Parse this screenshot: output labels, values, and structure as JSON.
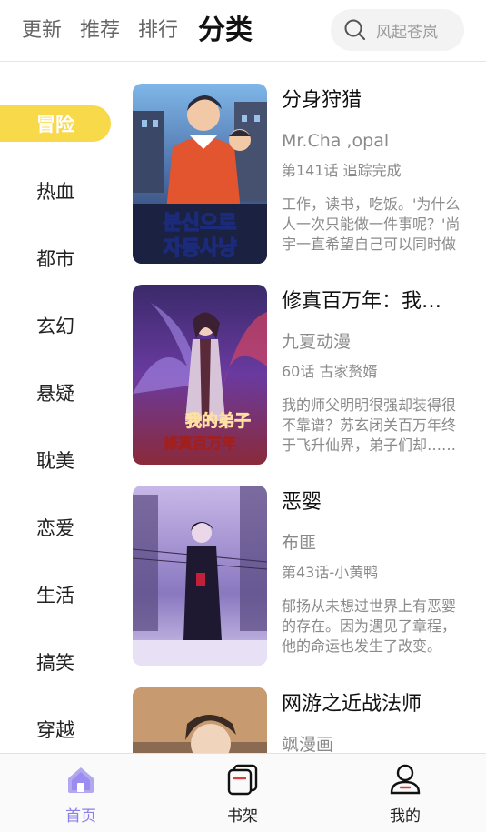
{
  "header": {
    "tabs": [
      {
        "label": "更新"
      },
      {
        "label": "推荐"
      },
      {
        "label": "排行"
      },
      {
        "label": "分类"
      }
    ],
    "search_placeholder": "风起苍岚"
  },
  "categories": [
    "冒险",
    "热血",
    "都市",
    "玄幻",
    "悬疑",
    "耽美",
    "恋爱",
    "生活",
    "搞笑",
    "穿越"
  ],
  "selected_category": "冒险",
  "comics": [
    {
      "title": "分身狩猎",
      "author": "Mr.Cha ,opal",
      "chapter": "第141话 追踪完成",
      "desc": "工作，读书，吃饭。'为什么人一次只能做一件事呢？'尚宇一直希望自己可以同时做很多事情。",
      "cover_text": "분신으로 자동사냥"
    },
    {
      "title": "修真百万年：我…",
      "author": "九夏动漫",
      "chapter": "60话 古家赘婿",
      "desc": "我的师父明明很强却装得很不靠谱？苏玄闭关百万年终于飞升仙界，弟子们却……",
      "cover_text": "我的弟子 修真百万年"
    },
    {
      "title": "恶婴",
      "author": "布匪",
      "chapter": "第43话-小黄鸭",
      "desc": "郁扬从未想过世界上有恶婴的存在。因为遇见了章程，他的命运也发生了改变。",
      "cover_text": ""
    },
    {
      "title": "网游之近战法师",
      "author": "飒漫画",
      "chapter": "",
      "desc": "",
      "cover_text": ""
    }
  ],
  "bottom_nav": [
    {
      "label": "首页",
      "icon": "home-icon"
    },
    {
      "label": "书架",
      "icon": "bookshelf-icon"
    },
    {
      "label": "我的",
      "icon": "profile-icon"
    }
  ],
  "colors": {
    "accent_yellow": "#f8d94a",
    "nav_active": "#8a7fe8"
  }
}
